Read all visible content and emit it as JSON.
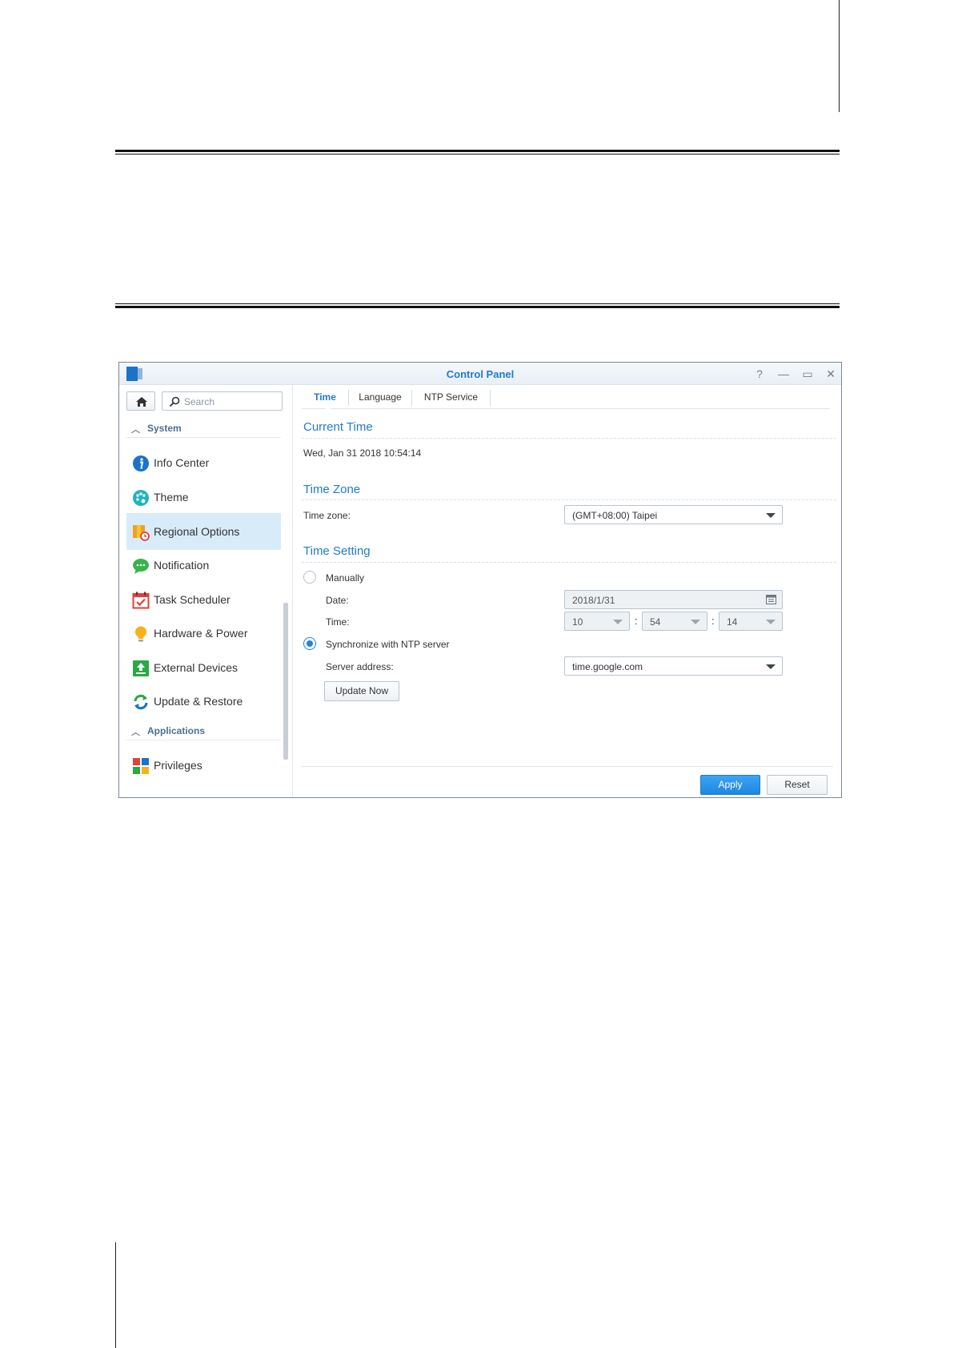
{
  "window": {
    "title": "Control Panel",
    "controls": {
      "help": "?",
      "minimize": "—",
      "maximize": "▭",
      "close": "✕"
    }
  },
  "sidebar": {
    "search_placeholder": "Search",
    "sections": [
      {
        "label": "System"
      },
      {
        "label": "Applications"
      }
    ],
    "items": [
      {
        "label": "Info Center",
        "icon": "info-icon"
      },
      {
        "label": "Theme",
        "icon": "palette-icon"
      },
      {
        "label": "Regional Options",
        "icon": "regional-icon",
        "selected": true
      },
      {
        "label": "Notification",
        "icon": "chat-bubble-icon"
      },
      {
        "label": "Task Scheduler",
        "icon": "calendar-check-icon"
      },
      {
        "label": "Hardware & Power",
        "icon": "bulb-icon"
      },
      {
        "label": "External Devices",
        "icon": "upload-icon"
      },
      {
        "label": "Update & Restore",
        "icon": "refresh-icon"
      },
      {
        "label": "Privileges",
        "icon": "privileges-icon"
      }
    ]
  },
  "tabs": [
    {
      "label": "Time",
      "active": true
    },
    {
      "label": "Language"
    },
    {
      "label": "NTP Service"
    }
  ],
  "current_time": {
    "title": "Current Time",
    "value": "Wed, Jan 31 2018 10:54:14"
  },
  "time_zone": {
    "title": "Time Zone",
    "label": "Time zone:",
    "value": "(GMT+08:00) Taipei"
  },
  "time_setting": {
    "title": "Time Setting",
    "manually_label": "Manually",
    "date_label": "Date:",
    "date_value": "2018/1/31",
    "time_label": "Time:",
    "hour": "10",
    "minute": "54",
    "second": "14",
    "colon": ":",
    "sync_label": "Synchronize with NTP server",
    "selected_mode": "sync",
    "server_label": "Server address:",
    "server_value": "time.google.com",
    "update_button": "Update Now"
  },
  "footer": {
    "apply": "Apply",
    "reset": "Reset"
  },
  "colors": {
    "accent": "#1f7ad0",
    "selected_bg": "#d8ebf8",
    "primary_button": "#2a93e8"
  }
}
